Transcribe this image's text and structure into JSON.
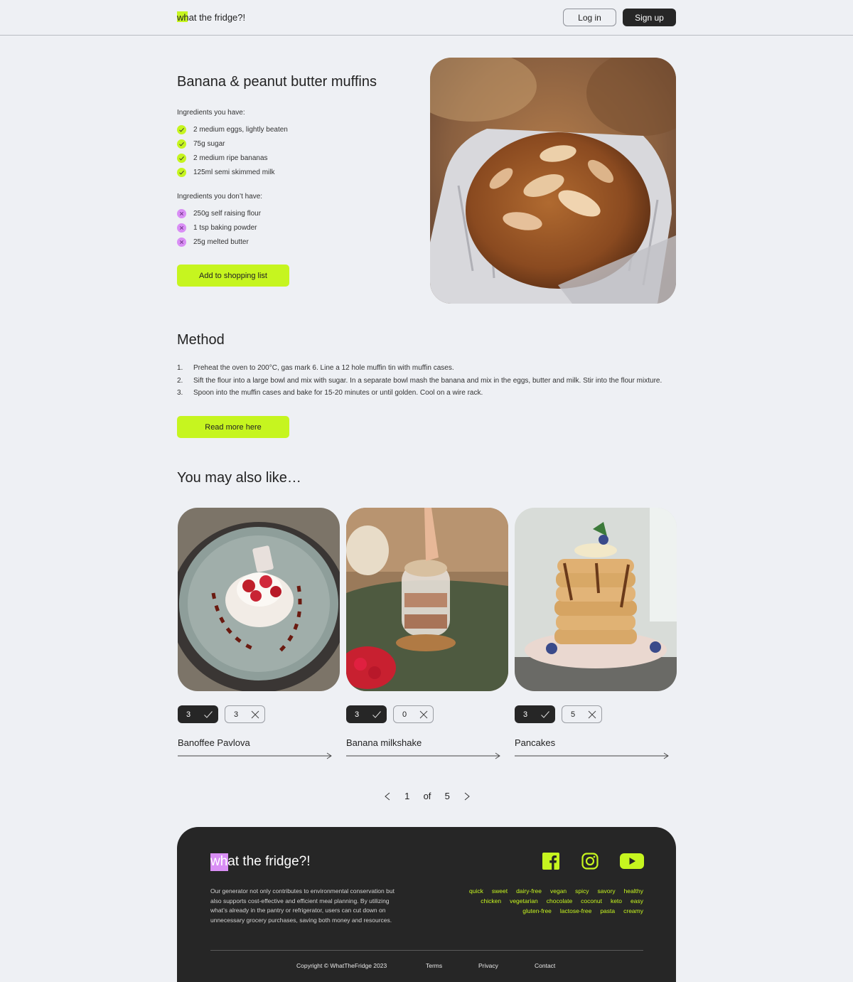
{
  "header": {
    "logo": "what the fridge?!",
    "login_label": "Log in",
    "signup_label": "Sign up"
  },
  "recipe": {
    "title": "Banana & peanut butter muffins",
    "have_heading": "Ingredients you have:",
    "have": [
      "2 medium eggs, lightly beaten",
      "75g sugar",
      "2 medium ripe bananas",
      "125ml semi skimmed milk"
    ],
    "missing_heading": "Ingredients you don’t have:",
    "missing": [
      "250g self raising flour",
      "1 tsp baking powder",
      "25g melted butter"
    ],
    "add_button": "Add to shopping list"
  },
  "method": {
    "title": "Method",
    "steps": [
      {
        "n": "1.",
        "text": "Preheat the oven to 200°C, gas mark 6. Line a 12 hole muffin tin with muffin cases."
      },
      {
        "n": "2.",
        "text": "Sift the flour into a large bowl and mix with sugar. In a separate bowl mash the banana and mix in the eggs, butter and milk. Stir into the flour mixture."
      },
      {
        "n": "3.",
        "text": "Spoon into the muffin cases and bake for 15-20 minutes or until golden. Cool on a wire rack."
      }
    ],
    "read_more": "Read more here"
  },
  "also": {
    "title": "You may also like…",
    "cards": [
      {
        "name": "Banoffee Pavlova",
        "have": "3",
        "missing": "3"
      },
      {
        "name": "Banana milkshake",
        "have": "3",
        "missing": "0"
      },
      {
        "name": "Pancakes",
        "have": "3",
        "missing": "5"
      }
    ]
  },
  "pager": {
    "current": "1",
    "of": "of",
    "total": "5"
  },
  "footer": {
    "logo": "what the fridge?!",
    "description": "Our generator not only contributes to environmental conservation but also supports cost-effective and efficient meal planning. By utilizing what’s already in the pantry or refrigerator, users can cut down on unnecessary grocery purchases, saving both money and resources.",
    "tags_row1": [
      "quick",
      "sweet",
      "dairy-free",
      "vegan",
      "spicy",
      "savory",
      "healthy"
    ],
    "tags_row2": [
      "chicken",
      "vegetarian",
      "chocolate",
      "coconut",
      "keto",
      "easy"
    ],
    "tags_row3": [
      "gluten-free",
      "lactose-free",
      "pasta",
      "creamy"
    ],
    "copyright": "Copyright © WhatTheFridge 2023",
    "terms": "Terms",
    "privacy": "Privacy",
    "contact": "Contact",
    "social_icons": [
      "facebook-icon",
      "instagram-icon",
      "youtube-icon"
    ]
  },
  "colors": {
    "accent": "#c6f51f",
    "missing": "#d98ef5",
    "dark": "#262626",
    "bg": "#eef0f4"
  }
}
